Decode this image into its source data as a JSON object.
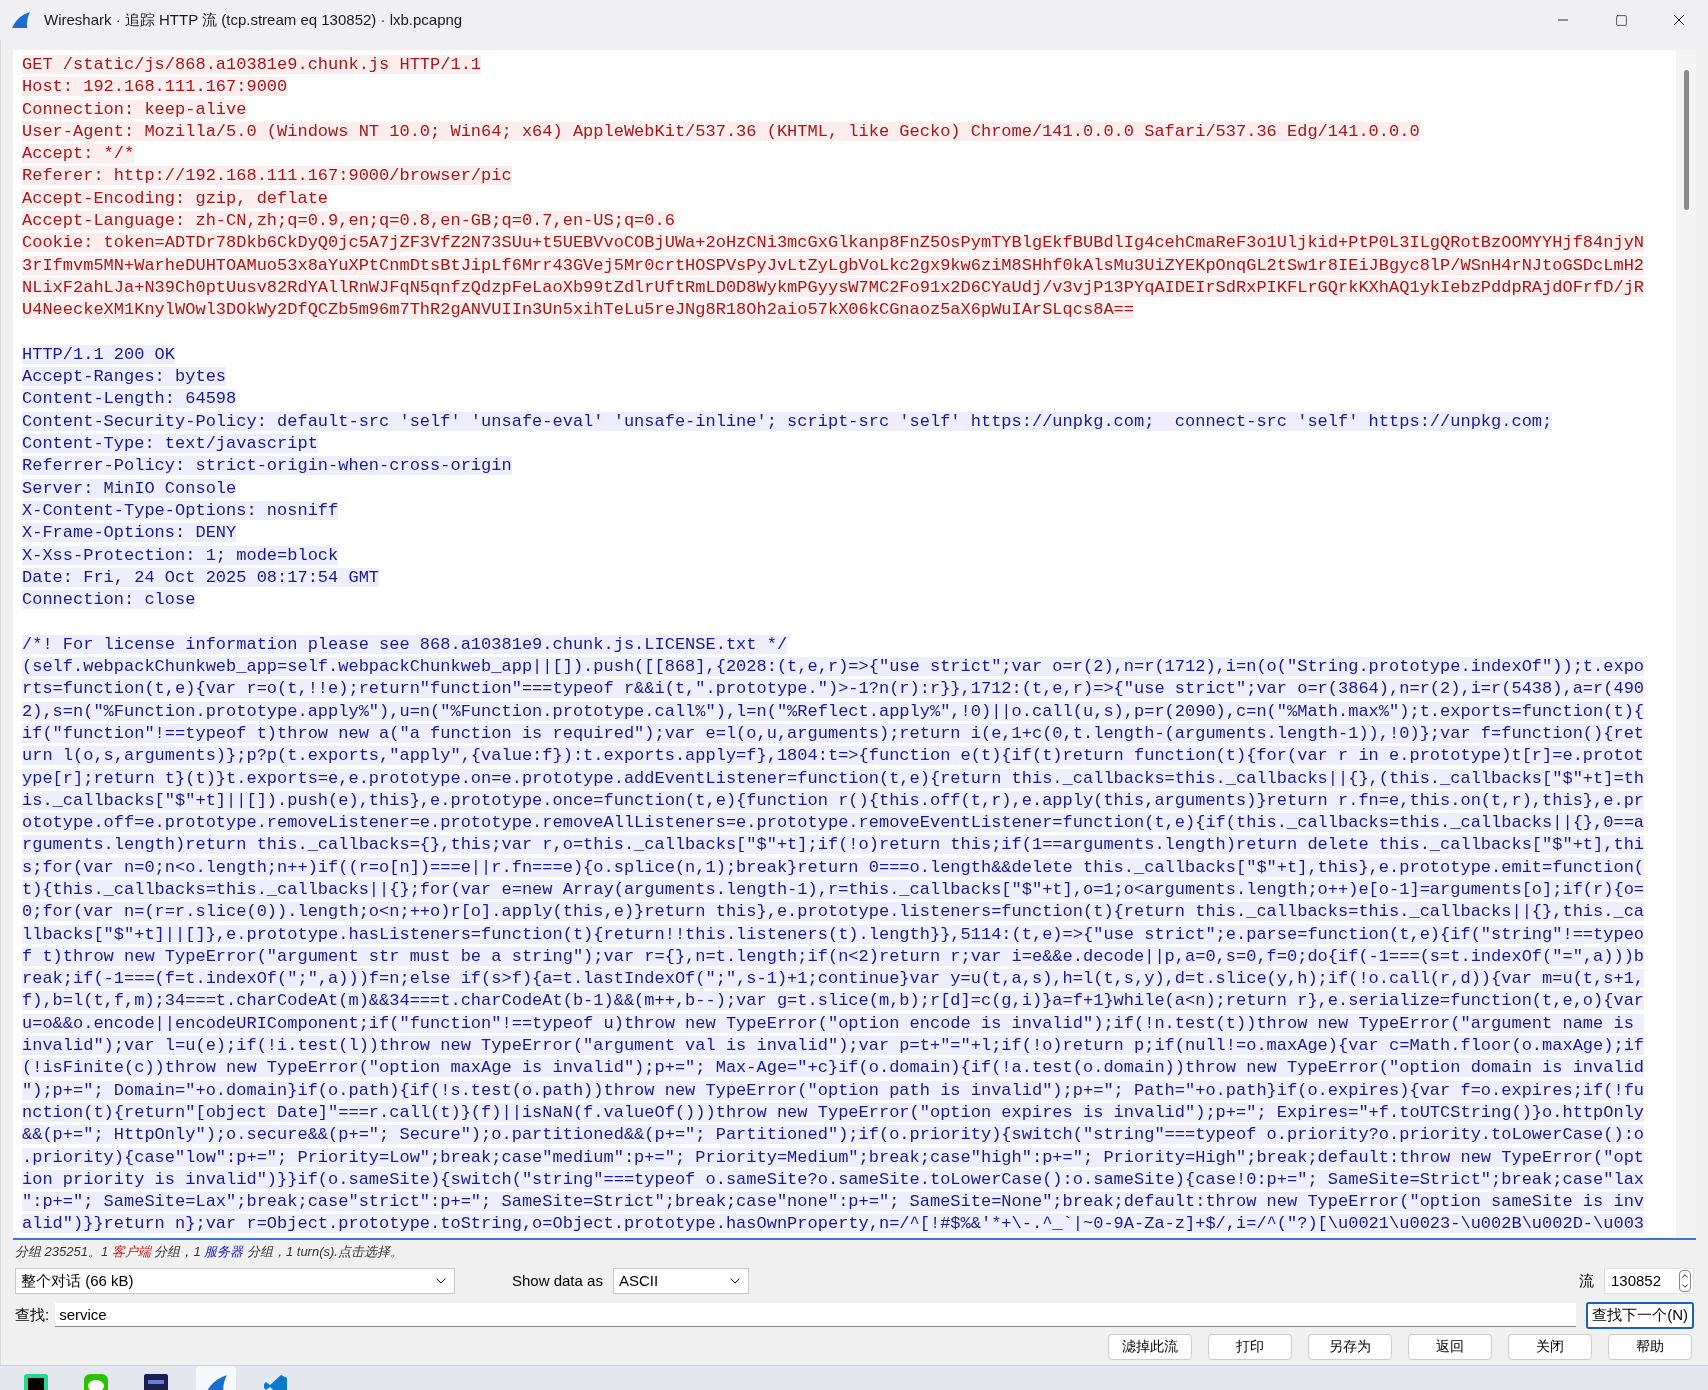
{
  "window": {
    "title": "Wireshark · 追踪 HTTP 流 (tcp.stream eq 130852) · lxb.pcapng"
  },
  "stream": [
    {
      "kind": "client",
      "lines": [
        "GET /static/js/868.a10381e9.chunk.js HTTP/1.1",
        "Host: 192.168.111.167:9000",
        "Connection: keep-alive",
        "User-Agent: Mozilla/5.0 (Windows NT 10.0; Win64; x64) AppleWebKit/537.36 (KHTML, like Gecko) Chrome/141.0.0.0 Safari/537.36 Edg/141.0.0.0",
        "Accept: */*",
        "Referer: http://192.168.111.167:9000/browser/pic",
        "Accept-Encoding: gzip, deflate",
        "Accept-Language: zh-CN,zh;q=0.9,en;q=0.8,en-GB;q=0.7,en-US;q=0.6",
        "Cookie: token=ADTDr78Dkb6CkDyQ0jc5A7jZF3VfZ2N73SUu+t5UEBVvoCOBjUWa+2oHzCNi3mcGxGlkanp8FnZ5OsPymTYBlgEkfBUBdlIg4cehCmaReF3o1Uljkid+PtP0L3ILgQRotBzOOMYYHjf84njyN",
        "3rIfmvm5MN+WarheDUHTOAMuo53x8aYuXPtCnmDtsBtJipLf6Mrr43GVej5Mr0crtHOSPVsPyJvLtZyLgbVoLkc2gx9kw6ziM8SHhf0kAlsMu3UiZYEKpOnqGL2tSw1r8IEiJBgyc8lP/WSnH4rNJtoGSDcLmH2",
        "NLixF2ahLJa+N39Ch0ptUusv82RdYAllRnWJFqN5qnfzQdzpFeLaoXb99tZdlrUftRmLD0D8WykmPGyysW7MC2Fo91x2D6CYaUdj/v3vjP13PYqAIDEIrSdRxPIKFLrGQrkKXhAQ1ykIebzPddpRAjdOFrfD/jR",
        "U4NeeckeXM1KnylWOwl3DOkWy2DfQCZb5m96m7ThR2gANVUIIn3Un5xihTeLu5reJNg8R18Oh2aio57kX06kCGnaoz5aX6pWuIArSLqcs8A=="
      ]
    },
    {
      "kind": "server",
      "lines": [
        "HTTP/1.1 200 OK",
        "Accept-Ranges: bytes",
        "Content-Length: 64598",
        "Content-Security-Policy: default-src 'self' 'unsafe-eval' 'unsafe-inline'; script-src 'self' https://unpkg.com;  connect-src 'self' https://unpkg.com;",
        "Content-Type: text/javascript",
        "Referrer-Policy: strict-origin-when-cross-origin",
        "Server: MinIO Console",
        "X-Content-Type-Options: nosniff",
        "X-Frame-Options: DENY",
        "X-Xss-Protection: 1; mode=block",
        "Date: Fri, 24 Oct 2025 08:17:54 GMT",
        "Connection: close"
      ]
    },
    {
      "kind": "server",
      "lines": [
        "/*! For license information please see 868.a10381e9.chunk.js.LICENSE.txt */",
        "(self.webpackChunkweb_app=self.webpackChunkweb_app||[]).push([[868],{2028:(t,e,r)=>{\"use strict\";var o=r(2),n=r(1712),i=n(o(\"String.prototype.indexOf\"));t.expo",
        "rts=function(t,e){var r=o(t,!!e);return\"function\"===typeof r&&i(t,\".prototype.\")>-1?n(r):r}},1712:(t,e,r)=>{\"use strict\";var o=r(3864),n=r(2),i=r(5438),a=r(490",
        "2),s=n(\"%Function.prototype.apply%\"),u=n(\"%Function.prototype.call%\"),l=n(\"%Reflect.apply%\",!0)||o.call(u,s),p=r(2090),c=n(\"%Math.max%\");t.exports=function(t){",
        "if(\"function\"!==typeof t)throw new a(\"a function is required\");var e=l(o,u,arguments);return i(e,1+c(0,t.length-(arguments.length-1)),!0)};var f=function(){ret",
        "urn l(o,s,arguments)};p?p(t.exports,\"apply\",{value:f}):t.exports.apply=f},1804:t=>{function e(t){if(t)return function(t){for(var r in e.prototype)t[r]=e.protot",
        "ype[r];return t}(t)}t.exports=e,e.prototype.on=e.prototype.addEventListener=function(t,e){return this._callbacks=this._callbacks||{},(this._callbacks[\"$\"+t]=th",
        "is._callbacks[\"$\"+t]||[]).push(e),this},e.prototype.once=function(t,e){function r(){this.off(t,r),e.apply(this,arguments)}return r.fn=e,this.on(t,r),this},e.pr",
        "ototype.off=e.prototype.removeListener=e.prototype.removeAllListeners=e.prototype.removeEventListener=function(t,e){if(this._callbacks=this._callbacks||{},0==a",
        "rguments.length)return this._callbacks={},this;var r,o=this._callbacks[\"$\"+t];if(!o)return this;if(1==arguments.length)return delete this._callbacks[\"$\"+t],thi",
        "s;for(var n=0;n<o.length;n++)if((r=o[n])===e||r.fn===e){o.splice(n,1);break}return 0===o.length&&delete this._callbacks[\"$\"+t],this},e.prototype.emit=function(",
        "t){this._callbacks=this._callbacks||{};for(var e=new Array(arguments.length-1),r=this._callbacks[\"$\"+t],o=1;o<arguments.length;o++)e[o-1]=arguments[o];if(r){o=",
        "0;for(var n=(r=r.slice(0)).length;o<n;++o)r[o].apply(this,e)}return this},e.prototype.listeners=function(t){return this._callbacks=this._callbacks||{},this._ca",
        "llbacks[\"$\"+t]||[]},e.prototype.hasListeners=function(t){return!!this.listeners(t).length}},5114:(t,e)=>{\"use strict\";e.parse=function(t,e){if(\"string\"!==typeo",
        "f t)throw new TypeError(\"argument str must be a string\");var r={},n=t.length;if(n<2)return r;var i=e&&e.decode||p,a=0,s=0,f=0;do{if(-1===(s=t.indexOf(\"=\",a)))b",
        "reak;if(-1===(f=t.indexOf(\";\",a)))f=n;else if(s>f){a=t.lastIndexOf(\";\",s-1)+1;continue}var y=u(t,a,s),h=l(t,s,y),d=t.slice(y,h);if(!o.call(r,d)){var m=u(t,s+1,",
        "f),b=l(t,f,m);34===t.charCodeAt(m)&&34===t.charCodeAt(b-1)&&(m++,b--);var g=t.slice(m,b);r[d]=c(g,i)}a=f+1}while(a<n);return r},e.serialize=function(t,e,o){var",
        "u=o&&o.encode||encodeURIComponent;if(\"function\"!==typeof u)throw new TypeError(\"option encode is invalid\");if(!n.test(t))throw new TypeError(\"argument name is ",
        "invalid\");var l=u(e);if(!i.test(l))throw new TypeError(\"argument val is invalid\");var p=t+\"=\"+l;if(!o)return p;if(null!=o.maxAge){var c=Math.floor(o.maxAge);if",
        "(!isFinite(c))throw new TypeError(\"option maxAge is invalid\");p+=\"; Max-Age=\"+c}if(o.domain){if(!a.test(o.domain))throw new TypeError(\"option domain is invalid",
        "\");p+=\"; Domain=\"+o.domain}if(o.path){if(!s.test(o.path))throw new TypeError(\"option path is invalid\");p+=\"; Path=\"+o.path}if(o.expires){var f=o.expires;if(!fu",
        "nction(t){return\"[object Date]\"===r.call(t)}(f)||isNaN(f.valueOf()))throw new TypeError(\"option expires is invalid\");p+=\"; Expires=\"+f.toUTCString()}o.httpOnly",
        "&&(p+=\"; HttpOnly\");o.secure&&(p+=\"; Secure\");o.partitioned&&(p+=\"; Partitioned\");if(o.priority){switch(\"string\"===typeof o.priority?o.priority.toLowerCase():o",
        ".priority){case\"low\":p+=\"; Priority=Low\";break;case\"medium\":p+=\"; Priority=Medium\";break;case\"high\":p+=\"; Priority=High\";break;default:throw new TypeError(\"opt",
        "ion priority is invalid\")}}if(o.sameSite){switch(\"string\"===typeof o.sameSite?o.sameSite.toLowerCase():o.sameSite){case!0:p+=\"; SameSite=Strict\";break;case\"lax",
        "\":p+=\"; SameSite=Lax\";break;case\"strict\":p+=\"; SameSite=Strict\";break;case\"none\":p+=\"; SameSite=None\";break;default:throw new TypeError(\"option sameSite is inv",
        "alid\")}}return n};var r=Object.prototype.toString,o=Object.prototype.hasOwnProperty,n=/^[!#$%&'*+\\-.^_`|~0-9A-Za-z]+$/,i=/^(\"?)[\\u0021\\u0023-\\u002B\\u002D-\\u003"
      ]
    }
  ],
  "status": [
    {
      "text": "分组 235251。1 ",
      "kind": "plain"
    },
    {
      "text": "客户端",
      "kind": "client"
    },
    {
      "text": " 分组，1 ",
      "kind": "plain"
    },
    {
      "text": "服务器",
      "kind": "server"
    },
    {
      "text": " 分组，1 turn(s).点击选择。",
      "kind": "plain"
    }
  ],
  "conversation": {
    "value": "整个对话 (66 kB)"
  },
  "show_data_as": {
    "label": "Show data as",
    "value": "ASCII"
  },
  "stream_number": {
    "label": "流",
    "value": "130852"
  },
  "find": {
    "label": "查找:",
    "value": "service",
    "button": "查找下一个(N)"
  },
  "buttons": [
    "滤掉此流",
    "打印",
    "另存为",
    "返回",
    "关闭",
    "帮助"
  ],
  "taskbar": [
    {
      "kind": "square-logo",
      "selected": false
    },
    {
      "kind": "chat",
      "selected": false
    },
    {
      "kind": "dark-square",
      "selected": false
    },
    {
      "kind": "fin",
      "selected": true
    },
    {
      "kind": "ribbon",
      "selected": false
    }
  ]
}
